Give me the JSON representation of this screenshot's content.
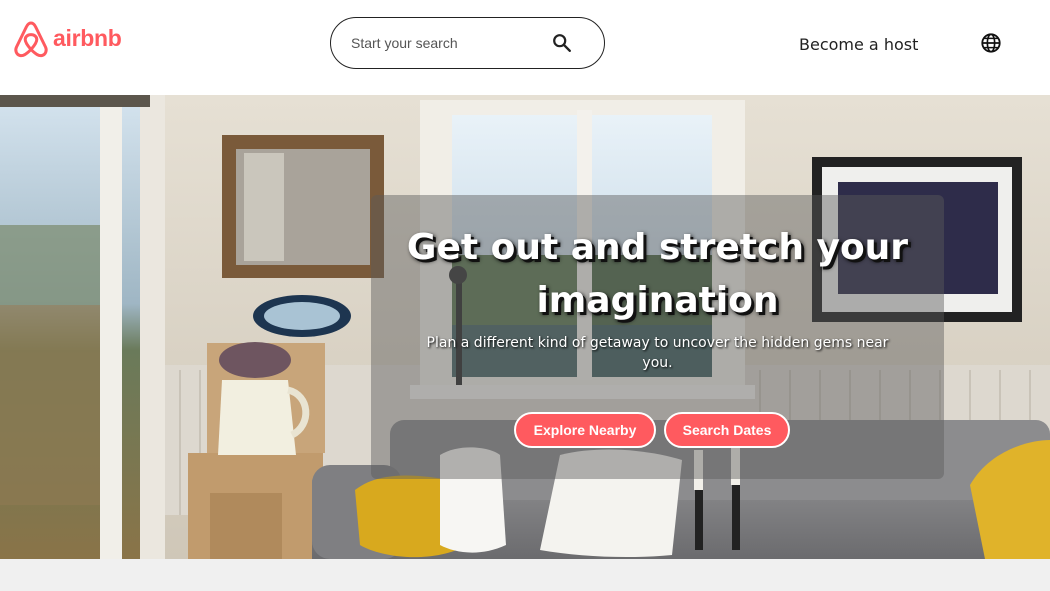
{
  "header": {
    "logo_text": "airbnb",
    "logo_icon": "airbnb-belo-icon",
    "search_placeholder": "Start your search",
    "search_icon": "search-icon",
    "host_link": "Become a host",
    "globe_icon": "globe-icon"
  },
  "hero": {
    "title": "Get out and stretch your imagination",
    "subtitle": "Plan a different kind of getaway to uncover the hidden gems near you.",
    "primary_button": "Explore Nearby",
    "secondary_button": "Search Dates"
  },
  "colors": {
    "brand": "#ff5a5f",
    "overlay": "rgba(90,90,90,0.45)",
    "text_dark": "#222222",
    "footer_strip": "#f0f0f0"
  }
}
